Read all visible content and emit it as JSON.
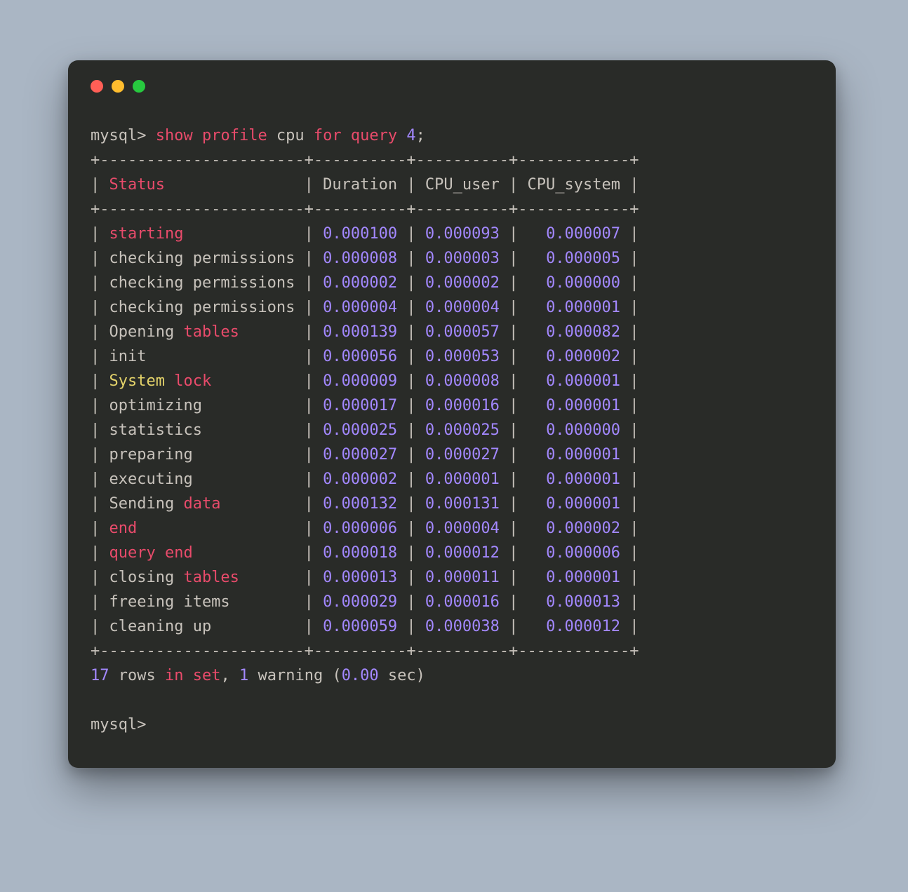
{
  "prompt": "mysql>",
  "command": {
    "tokens": [
      {
        "text": " ",
        "cls": "c-default"
      },
      {
        "text": "show",
        "cls": "c-pink"
      },
      {
        "text": " ",
        "cls": "c-default"
      },
      {
        "text": "profile",
        "cls": "c-pink"
      },
      {
        "text": " cpu ",
        "cls": "c-default"
      },
      {
        "text": "for",
        "cls": "c-pink"
      },
      {
        "text": " ",
        "cls": "c-default"
      },
      {
        "text": "query",
        "cls": "c-pink"
      },
      {
        "text": " ",
        "cls": "c-default"
      },
      {
        "text": "4",
        "cls": "c-purple"
      },
      {
        "text": ";",
        "cls": "c-default"
      }
    ]
  },
  "border_top": "+----------------------+----------+----------+------------+",
  "border_mid": "+----------------------+----------+----------+------------+",
  "border_bottom": "+----------------------+----------+----------+------------+",
  "header_row": {
    "tokens": [
      {
        "text": "| ",
        "cls": "c-default"
      },
      {
        "text": "Status",
        "cls": "c-pink"
      },
      {
        "text": "               | Duration | CPU_user | CPU_system |",
        "cls": "c-default"
      }
    ]
  },
  "rows": [
    {
      "tokens": [
        {
          "text": "| ",
          "cls": "c-default"
        },
        {
          "text": "starting",
          "cls": "c-pink"
        },
        {
          "text": "             | ",
          "cls": "c-default"
        },
        {
          "text": "0.000100",
          "cls": "c-purple"
        },
        {
          "text": " | ",
          "cls": "c-default"
        },
        {
          "text": "0.000093",
          "cls": "c-purple"
        },
        {
          "text": " |   ",
          "cls": "c-default"
        },
        {
          "text": "0.000007",
          "cls": "c-purple"
        },
        {
          "text": " |",
          "cls": "c-default"
        }
      ]
    },
    {
      "tokens": [
        {
          "text": "| checking permissions | ",
          "cls": "c-default"
        },
        {
          "text": "0.000008",
          "cls": "c-purple"
        },
        {
          "text": " | ",
          "cls": "c-default"
        },
        {
          "text": "0.000003",
          "cls": "c-purple"
        },
        {
          "text": " |   ",
          "cls": "c-default"
        },
        {
          "text": "0.000005",
          "cls": "c-purple"
        },
        {
          "text": " |",
          "cls": "c-default"
        }
      ]
    },
    {
      "tokens": [
        {
          "text": "| checking permissions | ",
          "cls": "c-default"
        },
        {
          "text": "0.000002",
          "cls": "c-purple"
        },
        {
          "text": " | ",
          "cls": "c-default"
        },
        {
          "text": "0.000002",
          "cls": "c-purple"
        },
        {
          "text": " |   ",
          "cls": "c-default"
        },
        {
          "text": "0.000000",
          "cls": "c-purple"
        },
        {
          "text": " |",
          "cls": "c-default"
        }
      ]
    },
    {
      "tokens": [
        {
          "text": "| checking permissions | ",
          "cls": "c-default"
        },
        {
          "text": "0.000004",
          "cls": "c-purple"
        },
        {
          "text": " | ",
          "cls": "c-default"
        },
        {
          "text": "0.000004",
          "cls": "c-purple"
        },
        {
          "text": " |   ",
          "cls": "c-default"
        },
        {
          "text": "0.000001",
          "cls": "c-purple"
        },
        {
          "text": " |",
          "cls": "c-default"
        }
      ]
    },
    {
      "tokens": [
        {
          "text": "| Opening ",
          "cls": "c-default"
        },
        {
          "text": "tables",
          "cls": "c-pink"
        },
        {
          "text": "       | ",
          "cls": "c-default"
        },
        {
          "text": "0.000139",
          "cls": "c-purple"
        },
        {
          "text": " | ",
          "cls": "c-default"
        },
        {
          "text": "0.000057",
          "cls": "c-purple"
        },
        {
          "text": " |   ",
          "cls": "c-default"
        },
        {
          "text": "0.000082",
          "cls": "c-purple"
        },
        {
          "text": " |",
          "cls": "c-default"
        }
      ]
    },
    {
      "tokens": [
        {
          "text": "| init                 | ",
          "cls": "c-default"
        },
        {
          "text": "0.000056",
          "cls": "c-purple"
        },
        {
          "text": " | ",
          "cls": "c-default"
        },
        {
          "text": "0.000053",
          "cls": "c-purple"
        },
        {
          "text": " |   ",
          "cls": "c-default"
        },
        {
          "text": "0.000002",
          "cls": "c-purple"
        },
        {
          "text": " |",
          "cls": "c-default"
        }
      ]
    },
    {
      "tokens": [
        {
          "text": "| ",
          "cls": "c-default"
        },
        {
          "text": "System",
          "cls": "c-yellow"
        },
        {
          "text": " ",
          "cls": "c-default"
        },
        {
          "text": "lock",
          "cls": "c-pink"
        },
        {
          "text": "          | ",
          "cls": "c-default"
        },
        {
          "text": "0.000009",
          "cls": "c-purple"
        },
        {
          "text": " | ",
          "cls": "c-default"
        },
        {
          "text": "0.000008",
          "cls": "c-purple"
        },
        {
          "text": " |   ",
          "cls": "c-default"
        },
        {
          "text": "0.000001",
          "cls": "c-purple"
        },
        {
          "text": " |",
          "cls": "c-default"
        }
      ]
    },
    {
      "tokens": [
        {
          "text": "| optimizing           | ",
          "cls": "c-default"
        },
        {
          "text": "0.000017",
          "cls": "c-purple"
        },
        {
          "text": " | ",
          "cls": "c-default"
        },
        {
          "text": "0.000016",
          "cls": "c-purple"
        },
        {
          "text": " |   ",
          "cls": "c-default"
        },
        {
          "text": "0.000001",
          "cls": "c-purple"
        },
        {
          "text": " |",
          "cls": "c-default"
        }
      ]
    },
    {
      "tokens": [
        {
          "text": "| statistics           | ",
          "cls": "c-default"
        },
        {
          "text": "0.000025",
          "cls": "c-purple"
        },
        {
          "text": " | ",
          "cls": "c-default"
        },
        {
          "text": "0.000025",
          "cls": "c-purple"
        },
        {
          "text": " |   ",
          "cls": "c-default"
        },
        {
          "text": "0.000000",
          "cls": "c-purple"
        },
        {
          "text": " |",
          "cls": "c-default"
        }
      ]
    },
    {
      "tokens": [
        {
          "text": "| preparing            | ",
          "cls": "c-default"
        },
        {
          "text": "0.000027",
          "cls": "c-purple"
        },
        {
          "text": " | ",
          "cls": "c-default"
        },
        {
          "text": "0.000027",
          "cls": "c-purple"
        },
        {
          "text": " |   ",
          "cls": "c-default"
        },
        {
          "text": "0.000001",
          "cls": "c-purple"
        },
        {
          "text": " |",
          "cls": "c-default"
        }
      ]
    },
    {
      "tokens": [
        {
          "text": "| executing            | ",
          "cls": "c-default"
        },
        {
          "text": "0.000002",
          "cls": "c-purple"
        },
        {
          "text": " | ",
          "cls": "c-default"
        },
        {
          "text": "0.000001",
          "cls": "c-purple"
        },
        {
          "text": " |   ",
          "cls": "c-default"
        },
        {
          "text": "0.000001",
          "cls": "c-purple"
        },
        {
          "text": " |",
          "cls": "c-default"
        }
      ]
    },
    {
      "tokens": [
        {
          "text": "| Sending ",
          "cls": "c-default"
        },
        {
          "text": "data",
          "cls": "c-pink"
        },
        {
          "text": "         | ",
          "cls": "c-default"
        },
        {
          "text": "0.000132",
          "cls": "c-purple"
        },
        {
          "text": " | ",
          "cls": "c-default"
        },
        {
          "text": "0.000131",
          "cls": "c-purple"
        },
        {
          "text": " |   ",
          "cls": "c-default"
        },
        {
          "text": "0.000001",
          "cls": "c-purple"
        },
        {
          "text": " |",
          "cls": "c-default"
        }
      ]
    },
    {
      "tokens": [
        {
          "text": "| ",
          "cls": "c-default"
        },
        {
          "text": "end",
          "cls": "c-pink"
        },
        {
          "text": "                  | ",
          "cls": "c-default"
        },
        {
          "text": "0.000006",
          "cls": "c-purple"
        },
        {
          "text": " | ",
          "cls": "c-default"
        },
        {
          "text": "0.000004",
          "cls": "c-purple"
        },
        {
          "text": " |   ",
          "cls": "c-default"
        },
        {
          "text": "0.000002",
          "cls": "c-purple"
        },
        {
          "text": " |",
          "cls": "c-default"
        }
      ]
    },
    {
      "tokens": [
        {
          "text": "| ",
          "cls": "c-default"
        },
        {
          "text": "query",
          "cls": "c-pink"
        },
        {
          "text": " ",
          "cls": "c-default"
        },
        {
          "text": "end",
          "cls": "c-pink"
        },
        {
          "text": "            | ",
          "cls": "c-default"
        },
        {
          "text": "0.000018",
          "cls": "c-purple"
        },
        {
          "text": " | ",
          "cls": "c-default"
        },
        {
          "text": "0.000012",
          "cls": "c-purple"
        },
        {
          "text": " |   ",
          "cls": "c-default"
        },
        {
          "text": "0.000006",
          "cls": "c-purple"
        },
        {
          "text": " |",
          "cls": "c-default"
        }
      ]
    },
    {
      "tokens": [
        {
          "text": "| closing ",
          "cls": "c-default"
        },
        {
          "text": "tables",
          "cls": "c-pink"
        },
        {
          "text": "       | ",
          "cls": "c-default"
        },
        {
          "text": "0.000013",
          "cls": "c-purple"
        },
        {
          "text": " | ",
          "cls": "c-default"
        },
        {
          "text": "0.000011",
          "cls": "c-purple"
        },
        {
          "text": " |   ",
          "cls": "c-default"
        },
        {
          "text": "0.000001",
          "cls": "c-purple"
        },
        {
          "text": " |",
          "cls": "c-default"
        }
      ]
    },
    {
      "tokens": [
        {
          "text": "| freeing items        | ",
          "cls": "c-default"
        },
        {
          "text": "0.000029",
          "cls": "c-purple"
        },
        {
          "text": " | ",
          "cls": "c-default"
        },
        {
          "text": "0.000016",
          "cls": "c-purple"
        },
        {
          "text": " |   ",
          "cls": "c-default"
        },
        {
          "text": "0.000013",
          "cls": "c-purple"
        },
        {
          "text": " |",
          "cls": "c-default"
        }
      ]
    },
    {
      "tokens": [
        {
          "text": "| cleaning up          | ",
          "cls": "c-default"
        },
        {
          "text": "0.000059",
          "cls": "c-purple"
        },
        {
          "text": " | ",
          "cls": "c-default"
        },
        {
          "text": "0.000038",
          "cls": "c-purple"
        },
        {
          "text": " |   ",
          "cls": "c-default"
        },
        {
          "text": "0.000012",
          "cls": "c-purple"
        },
        {
          "text": " |",
          "cls": "c-default"
        }
      ]
    }
  ],
  "summary": {
    "tokens": [
      {
        "text": "17",
        "cls": "c-purple"
      },
      {
        "text": " rows ",
        "cls": "c-default"
      },
      {
        "text": "in",
        "cls": "c-pink"
      },
      {
        "text": " ",
        "cls": "c-default"
      },
      {
        "text": "set",
        "cls": "c-pink"
      },
      {
        "text": ", ",
        "cls": "c-default"
      },
      {
        "text": "1",
        "cls": "c-purple"
      },
      {
        "text": " warning (",
        "cls": "c-default"
      },
      {
        "text": "0.00",
        "cls": "c-purple"
      },
      {
        "text": " sec)",
        "cls": "c-default"
      }
    ]
  },
  "prompt2": "mysql>"
}
